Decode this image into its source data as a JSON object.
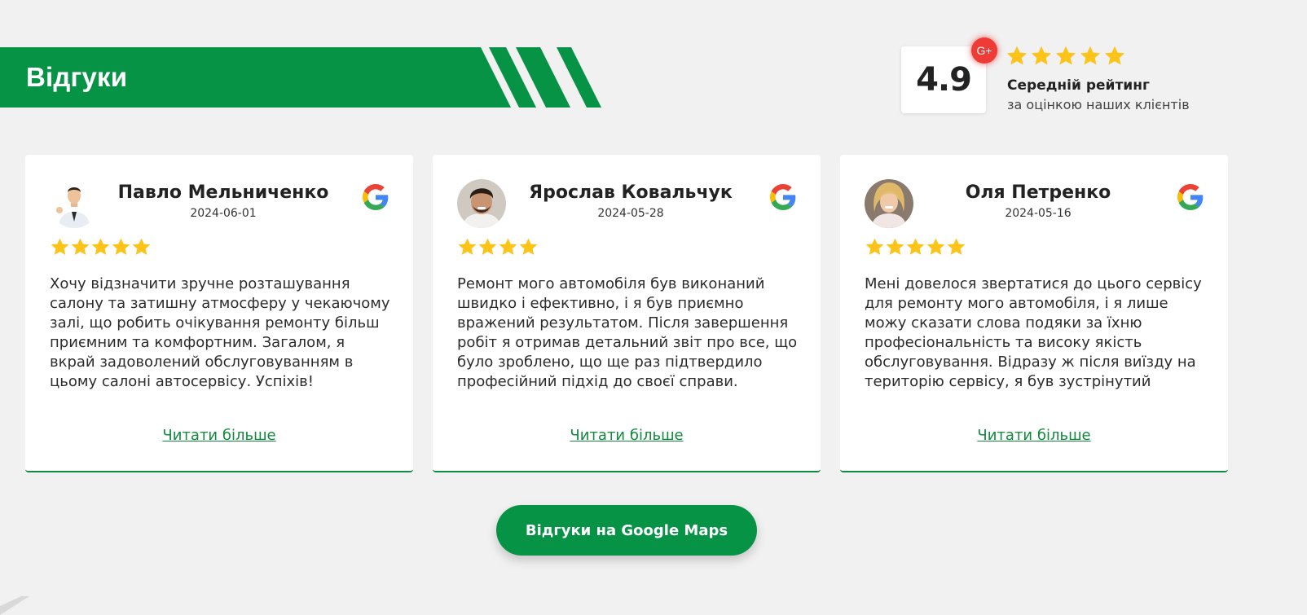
{
  "section": {
    "title": "Відгуки"
  },
  "rating": {
    "value": "4.9",
    "badge": "G+",
    "stars": 5,
    "label": "Середній рейтинг",
    "sublabel": "за оцінкою наших клієнтів"
  },
  "reviews": [
    {
      "name": "Павло Мельниченко",
      "date": "2024-06-01",
      "stars": 5,
      "text": "Хочу відзначити зручне розташування салону та затишну атмосферу у чекаючому залі, що робить очікування ремонту більш приємним та комфортним. Загалом, я вкрай задоволений обслуговуванням в цьому салоні автосервісу. Успіхів!",
      "read_more": "Читати більше"
    },
    {
      "name": "Ярослав Ковальчук",
      "date": "2024-05-28",
      "stars": 4,
      "text": "Ремонт мого автомобіля був виконаний швидко і ефективно, і я був приємно вражений результатом. Після завершення робіт я отримав детальний звіт про все, що було зроблено, що ще раз підтвердило професійний підхід до своєї справи.",
      "read_more": "Читати більше"
    },
    {
      "name": "Оля Петренко",
      "date": "2024-05-16",
      "stars": 5,
      "text": "Мені довелося звертатися до цього сервісу для ремонту мого автомобіля, і я лише можу сказати слова подяки за їхню професіональність та високу якість обслуговування. Відразу ж після виїзду на територію сервісу, я був зустрінутий",
      "read_more": "Читати більше"
    }
  ],
  "cta": {
    "label": "Відгуки на Google Maps"
  },
  "colors": {
    "brand_green": "#079346",
    "star_yellow": "#fcc419",
    "badge_red": "#ef3b36",
    "link_green": "#14883e"
  },
  "icons": {
    "google": "google-g-icon",
    "star": "star-icon",
    "gplus": "google-plus-icon"
  }
}
